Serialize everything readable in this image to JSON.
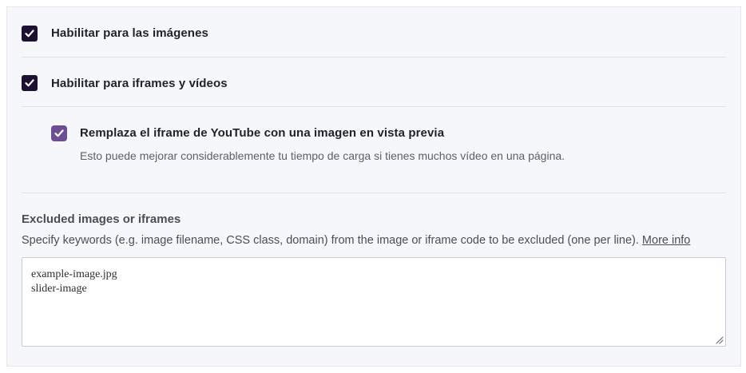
{
  "options": {
    "images": {
      "label": "Habilitar para las imágenes",
      "checked": true
    },
    "iframes": {
      "label": "Habilitar para iframes y vídeos",
      "checked": true
    },
    "youtube_preview": {
      "label": "Remplaza el iframe de YouTube con una imagen en vista previa",
      "description": "Esto puede mejorar considerablemente tu tiempo de carga si tienes muchos vídeo en una página.",
      "checked": true
    }
  },
  "exclusions": {
    "title": "Excluded images or iframes",
    "help_text": "Specify keywords (e.g. image filename, CSS class, domain) from the image or iframe code to be excluded (one per line).",
    "more_info_link": "More info",
    "value": "example-image.jpg\nslider-image"
  },
  "colors": {
    "checkbox_primary": "#1d1133",
    "checkbox_secondary": "#6e4e93",
    "panel_background": "#f6f7fa"
  },
  "icons": {
    "checkmark": "check-icon",
    "resize_grip": "resize-grip-icon"
  }
}
